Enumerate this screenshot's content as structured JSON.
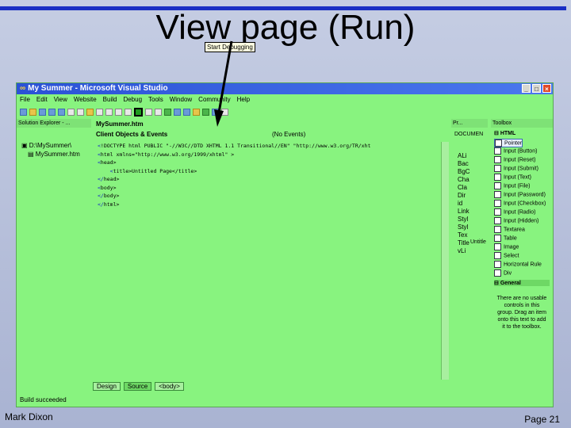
{
  "slide": {
    "title": "View page (Run)",
    "footer_left": "Mark Dixon",
    "footer_right": "Page 21"
  },
  "window": {
    "title": "My Summer - Microsoft Visual Studio",
    "menu": [
      "File",
      "Edit",
      "View",
      "Website",
      "Build",
      "Debug",
      "Tools",
      "Window",
      "Community",
      "Help"
    ],
    "tooltip": "Start Debugging",
    "status": "Build succeeded"
  },
  "solution_explorer": {
    "header": "Solution Explorer - ...",
    "root": "D:\\MySummer\\",
    "file": "MySummer.htm"
  },
  "editor": {
    "tab": "MySummer.htm",
    "object_selector": "Client Objects & Events",
    "event_selector": "(No Events)",
    "code_lines": [
      {
        "prefix": "<",
        "text": "!DOCTYPE html PUBLIC \"-//W3C//DTD XHTML 1.1 Transitional//EN\" \"http://www.w3.org/TR/xht"
      },
      {
        "prefix": "<",
        "text": "html xmlns=\"http://www.w3.org/1999/xhtml\" >"
      },
      {
        "prefix": "<",
        "text": "head>"
      },
      {
        "prefix": "    <",
        "text": "title>Untitled Page</title>"
      },
      {
        "prefix": "</",
        "text": "head>"
      },
      {
        "prefix": "<",
        "text": "body>"
      },
      {
        "prefix": "",
        "text": ""
      },
      {
        "prefix": "</",
        "text": "body>"
      },
      {
        "prefix": "</",
        "text": "html>"
      }
    ],
    "bottom_tabs": [
      "Design",
      "Source",
      "<body>"
    ]
  },
  "properties": {
    "header": "Pr...",
    "object": "DOCUMEN",
    "rows": [
      "ALi",
      "Bac",
      "BgC",
      "Cha",
      "Cla",
      "Dir",
      "id",
      "Link",
      "Styl",
      "Styl",
      "Tex",
      "Title",
      "vLi"
    ],
    "value": "Untitle"
  },
  "toolbox": {
    "header": "Toolbox",
    "group_html": "HTML",
    "items": [
      "Pointer",
      "Input (Button)",
      "Input (Reset)",
      "Input (Submit)",
      "Input (Text)",
      "Input (File)",
      "Input (Password)",
      "Input (Checkbox)",
      "Input (Radio)",
      "Input (Hidden)",
      "Textarea",
      "Table",
      "Image",
      "Select",
      "Horizontal Rule",
      "Div"
    ],
    "group_general": "General",
    "message": "There are no usable controls in this group. Drag an item onto this text to add it to the toolbox."
  }
}
